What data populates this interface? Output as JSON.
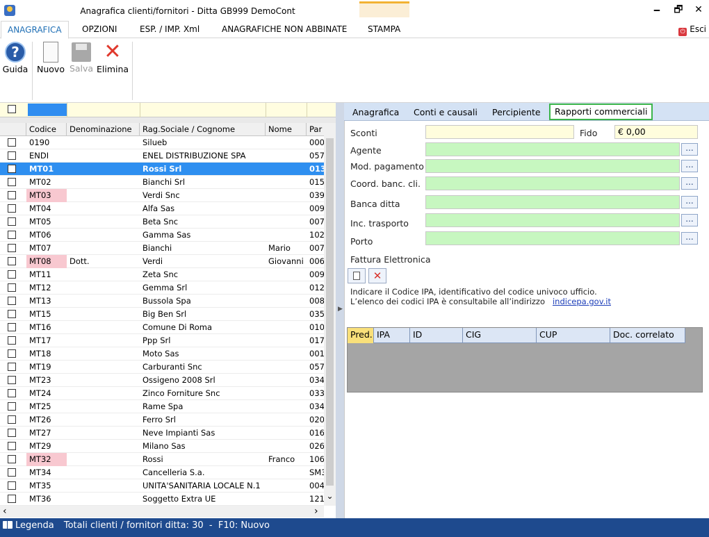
{
  "window": {
    "title": "Anagrafica clienti/fornitori - Ditta GB999 DemoCont",
    "minimize_label": "🗕",
    "restore_label": "🗗",
    "close_label": "✕"
  },
  "ribbon": {
    "tabs": [
      {
        "label": "ANAGRAFICA"
      },
      {
        "label": "OPZIONI"
      },
      {
        "label": "ESP. / IMP. Xml"
      },
      {
        "label": "ANAGRAFICHE NON ABBINATE"
      },
      {
        "label": "STAMPA"
      }
    ],
    "exit_label": "Esci"
  },
  "toolbar": {
    "guida_label": "Guida",
    "nuovo_label": "Nuovo",
    "salva_label": "Salva",
    "elimina_label": "Elimina"
  },
  "grid": {
    "columns": [
      "Codice",
      "Denominazione",
      "Rag.Sociale / Cognome",
      "Nome",
      "Par"
    ],
    "rows": [
      {
        "code": "0190",
        "denom": "",
        "rag": "Silueb",
        "nome": "",
        "par": "000"
      },
      {
        "code": "ENDI",
        "denom": "",
        "rag": "ENEL DISTRIBUZIONE SPA",
        "nome": "",
        "par": "057"
      },
      {
        "code": "MT01",
        "denom": "",
        "rag": "Rossi Srl",
        "nome": "",
        "par": "013"
      },
      {
        "code": "MT02",
        "denom": "",
        "rag": "Bianchi Srl",
        "nome": "",
        "par": "015"
      },
      {
        "code": "MT03",
        "denom": "",
        "rag": "Verdi Snc",
        "nome": "",
        "par": "039"
      },
      {
        "code": "MT04",
        "denom": "",
        "rag": "Alfa Sas",
        "nome": "",
        "par": "009"
      },
      {
        "code": "MT05",
        "denom": "",
        "rag": "Beta Snc",
        "nome": "",
        "par": "007"
      },
      {
        "code": "MT06",
        "denom": "",
        "rag": "Gamma Sas",
        "nome": "",
        "par": "102"
      },
      {
        "code": "MT07",
        "denom": "",
        "rag": "Bianchi",
        "nome": "Mario",
        "par": "007"
      },
      {
        "code": "MT08",
        "denom": "Dott.",
        "rag": "Verdi",
        "nome": "Giovanni",
        "par": "006"
      },
      {
        "code": "MT11",
        "denom": "",
        "rag": "Zeta Snc",
        "nome": "",
        "par": "009"
      },
      {
        "code": "MT12",
        "denom": "",
        "rag": "Gemma Srl",
        "nome": "",
        "par": "012"
      },
      {
        "code": "MT13",
        "denom": "",
        "rag": "Bussola Spa",
        "nome": "",
        "par": "008"
      },
      {
        "code": "MT15",
        "denom": "",
        "rag": "Big Ben Srl",
        "nome": "",
        "par": "035"
      },
      {
        "code": "MT16",
        "denom": "",
        "rag": "Comune Di Roma",
        "nome": "",
        "par": "010"
      },
      {
        "code": "MT17",
        "denom": "",
        "rag": "Ppp Srl",
        "nome": "",
        "par": "017"
      },
      {
        "code": "MT18",
        "denom": "",
        "rag": "Moto Sas",
        "nome": "",
        "par": "001"
      },
      {
        "code": "MT19",
        "denom": "",
        "rag": "Carburanti Snc",
        "nome": "",
        "par": "057"
      },
      {
        "code": "MT23",
        "denom": "",
        "rag": "Ossigeno 2008 Srl",
        "nome": "",
        "par": "034"
      },
      {
        "code": "MT24",
        "denom": "",
        "rag": "Zinco Forniture Snc",
        "nome": "",
        "par": "033"
      },
      {
        "code": "MT25",
        "denom": "",
        "rag": "Rame Spa",
        "nome": "",
        "par": "034"
      },
      {
        "code": "MT26",
        "denom": "",
        "rag": "Ferro Srl",
        "nome": "",
        "par": "020"
      },
      {
        "code": "MT27",
        "denom": "",
        "rag": "Neve Impianti Sas",
        "nome": "",
        "par": "016"
      },
      {
        "code": "MT29",
        "denom": "",
        "rag": "Milano Sas",
        "nome": "",
        "par": "026"
      },
      {
        "code": "MT32",
        "denom": "",
        "rag": "Rossi",
        "nome": "Franco",
        "par": "106"
      },
      {
        "code": "MT34",
        "denom": "",
        "rag": "Cancelleria S.a.",
        "nome": "",
        "par": "SM3"
      },
      {
        "code": "MT35",
        "denom": "",
        "rag": "UNITA'SANITARIA LOCALE N.1",
        "nome": "",
        "par": "004"
      },
      {
        "code": "MT36",
        "denom": "",
        "rag": "Soggetto Extra UE",
        "nome": "",
        "par": "121"
      }
    ],
    "selected_code": "MT01",
    "pink_codes": [
      "MT03",
      "MT08",
      "MT32"
    ],
    "scroll_down_glyph": "⌄",
    "scroll_left_glyph": "‹",
    "scroll_right_glyph": "›"
  },
  "detail": {
    "tabs": [
      {
        "label": "Anagrafica"
      },
      {
        "label": "Conti e causali"
      },
      {
        "label": "Percipiente"
      },
      {
        "label": "Rapporti commerciali"
      }
    ],
    "fields": {
      "sconti_label": "Sconti",
      "fido_label": "Fido",
      "fido_value": "€ 0,00",
      "agente_label": "Agente",
      "pagamento_label": "Mod. pagamento",
      "coord_label": "Coord. banc. cli.",
      "banca_label": "Banca ditta",
      "trasporto_label": "Inc. trasporto",
      "porto_label": "Porto",
      "lookup_label": "..."
    },
    "fattura": {
      "title": "Fattura Elettronica",
      "info_line1": "Indicare il Codice IPA, identificativo del codice univoco ufficio.",
      "info_line2": "L’elenco dei codici IPA è consultabile all’indirizzo",
      "link": "indicepa.gov.it",
      "columns": [
        "Pred.",
        "IPA",
        "ID",
        "CIG",
        "CUP",
        "Doc. correlato"
      ]
    }
  },
  "status": {
    "legend_label": "Legenda",
    "totals_text": "Totali clienti / fornitori ditta: 30  -  F10: Nuovo"
  }
}
